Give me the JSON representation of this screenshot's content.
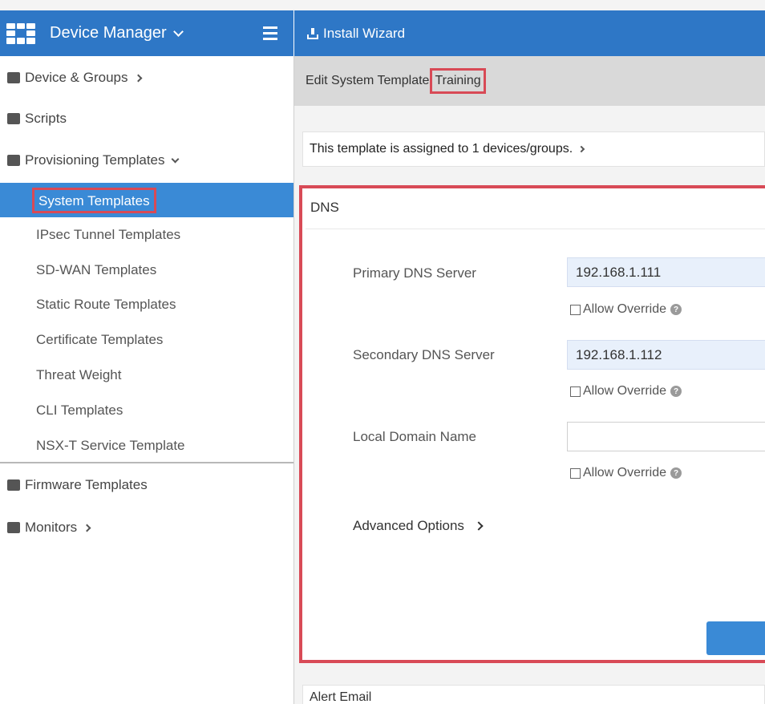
{
  "header": {
    "app_title": "Device Manager",
    "install_wizard": "Install Wizard"
  },
  "sidebar": {
    "items": [
      {
        "label": "Device & Groups",
        "icon": "device-groups-icon"
      },
      {
        "label": "Scripts",
        "icon": "scripts-icon"
      },
      {
        "label": "Provisioning Templates",
        "icon": "provisioning-icon"
      },
      {
        "label": "Firmware Templates",
        "icon": "firmware-icon"
      },
      {
        "label": "Monitors",
        "icon": "monitor-icon"
      }
    ],
    "sub_items": [
      {
        "label": "System Templates",
        "selected": true
      },
      {
        "label": "IPsec Tunnel Templates"
      },
      {
        "label": "SD-WAN Templates"
      },
      {
        "label": "Static Route Templates"
      },
      {
        "label": "Certificate Templates"
      },
      {
        "label": "Threat Weight"
      },
      {
        "label": "CLI Templates"
      },
      {
        "label": "NSX-T Service Template"
      }
    ]
  },
  "main": {
    "edit_prefix": "Edit System Template",
    "template_name": "Training",
    "assigned_text": "This template is assigned to 1 devices/groups.",
    "dns": {
      "title": "DNS",
      "primary_label": "Primary DNS Server",
      "primary_value": "192.168.1.111",
      "secondary_label": "Secondary DNS Server",
      "secondary_value": "192.168.1.112",
      "domain_label": "Local Domain Name",
      "domain_value": "",
      "allow_override": "Allow Override",
      "advanced_options": "Advanced Options"
    },
    "alert_email": "Alert Email"
  },
  "colors": {
    "header_blue": "#2e77c6",
    "selected_blue": "#3a8ad6",
    "highlight_red": "#d84a56"
  }
}
